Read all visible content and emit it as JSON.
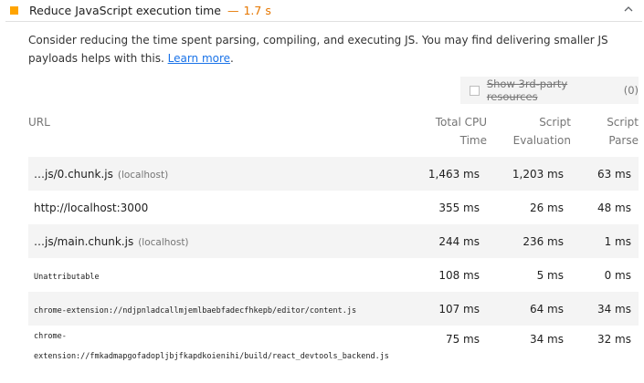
{
  "audit": {
    "title": "Reduce JavaScript execution time",
    "dash": "—",
    "value": "1.7 s",
    "warn_color": "#ffa400",
    "value_color": "#e67700"
  },
  "description": {
    "text": "Consider reducing the time spent parsing, compiling, and executing JS. You may find delivering smaller JS payloads helps with this.",
    "link": "Learn more",
    "after": "."
  },
  "third_party": {
    "label": "Show 3rd-party resources",
    "count": "(0)",
    "checked": false
  },
  "table": {
    "headers": {
      "url": "URL",
      "total_cpu_1": "Total CPU",
      "total_cpu_2": "Time",
      "script_eval_1": "Script",
      "script_eval_2": "Evaluation",
      "script_parse_1": "Script",
      "script_parse_2": "Parse"
    },
    "rows": [
      {
        "url": "…js/0.chunk.js",
        "host": "(localhost)",
        "total": "1,463 ms",
        "eval": "1,203 ms",
        "parse": "63 ms"
      },
      {
        "url": "http://localhost:3000",
        "host": "",
        "total": "355 ms",
        "eval": "26 ms",
        "parse": "48 ms"
      },
      {
        "url": "…js/main.chunk.js",
        "host": "(localhost)",
        "total": "244 ms",
        "eval": "236 ms",
        "parse": "1 ms"
      },
      {
        "url": "Unattributable",
        "host": "",
        "total": "108 ms",
        "eval": "5 ms",
        "parse": "0 ms"
      },
      {
        "url": "chrome-extension://ndjpnladcallmjemlbaebfadecfhkepb/editor/content.js",
        "host": "",
        "total": "107 ms",
        "eval": "64 ms",
        "parse": "34 ms"
      },
      {
        "url_line1": "chrome-",
        "url_line2": "extension://fmkadmapgofadopljbjfkapdkoienihi/build/react_devtools_backend.js",
        "host": "",
        "total": "75 ms",
        "eval": "34 ms",
        "parse": "32 ms"
      }
    ]
  }
}
